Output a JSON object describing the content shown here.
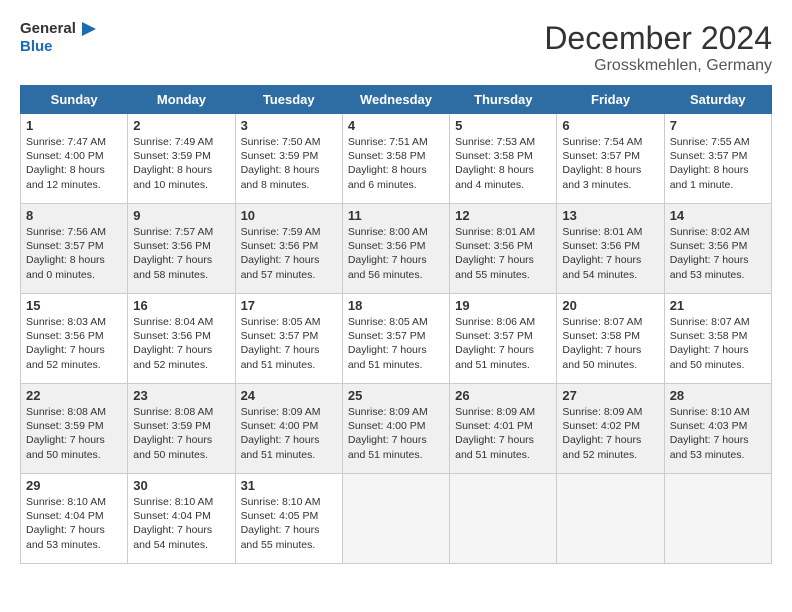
{
  "header": {
    "logo_line1": "General",
    "logo_line2": "Blue",
    "title": "December 2024",
    "subtitle": "Grosskmehlen, Germany"
  },
  "days_of_week": [
    "Sunday",
    "Monday",
    "Tuesday",
    "Wednesday",
    "Thursday",
    "Friday",
    "Saturday"
  ],
  "weeks": [
    [
      {
        "num": "1",
        "info": "Sunrise: 7:47 AM\nSunset: 4:00 PM\nDaylight: 8 hours\nand 12 minutes.",
        "shade": false
      },
      {
        "num": "2",
        "info": "Sunrise: 7:49 AM\nSunset: 3:59 PM\nDaylight: 8 hours\nand 10 minutes.",
        "shade": false
      },
      {
        "num": "3",
        "info": "Sunrise: 7:50 AM\nSunset: 3:59 PM\nDaylight: 8 hours\nand 8 minutes.",
        "shade": false
      },
      {
        "num": "4",
        "info": "Sunrise: 7:51 AM\nSunset: 3:58 PM\nDaylight: 8 hours\nand 6 minutes.",
        "shade": false
      },
      {
        "num": "5",
        "info": "Sunrise: 7:53 AM\nSunset: 3:58 PM\nDaylight: 8 hours\nand 4 minutes.",
        "shade": false
      },
      {
        "num": "6",
        "info": "Sunrise: 7:54 AM\nSunset: 3:57 PM\nDaylight: 8 hours\nand 3 minutes.",
        "shade": false
      },
      {
        "num": "7",
        "info": "Sunrise: 7:55 AM\nSunset: 3:57 PM\nDaylight: 8 hours\nand 1 minute.",
        "shade": false
      }
    ],
    [
      {
        "num": "8",
        "info": "Sunrise: 7:56 AM\nSunset: 3:57 PM\nDaylight: 8 hours\nand 0 minutes.",
        "shade": true
      },
      {
        "num": "9",
        "info": "Sunrise: 7:57 AM\nSunset: 3:56 PM\nDaylight: 7 hours\nand 58 minutes.",
        "shade": true
      },
      {
        "num": "10",
        "info": "Sunrise: 7:59 AM\nSunset: 3:56 PM\nDaylight: 7 hours\nand 57 minutes.",
        "shade": true
      },
      {
        "num": "11",
        "info": "Sunrise: 8:00 AM\nSunset: 3:56 PM\nDaylight: 7 hours\nand 56 minutes.",
        "shade": true
      },
      {
        "num": "12",
        "info": "Sunrise: 8:01 AM\nSunset: 3:56 PM\nDaylight: 7 hours\nand 55 minutes.",
        "shade": true
      },
      {
        "num": "13",
        "info": "Sunrise: 8:01 AM\nSunset: 3:56 PM\nDaylight: 7 hours\nand 54 minutes.",
        "shade": true
      },
      {
        "num": "14",
        "info": "Sunrise: 8:02 AM\nSunset: 3:56 PM\nDaylight: 7 hours\nand 53 minutes.",
        "shade": true
      }
    ],
    [
      {
        "num": "15",
        "info": "Sunrise: 8:03 AM\nSunset: 3:56 PM\nDaylight: 7 hours\nand 52 minutes.",
        "shade": false
      },
      {
        "num": "16",
        "info": "Sunrise: 8:04 AM\nSunset: 3:56 PM\nDaylight: 7 hours\nand 52 minutes.",
        "shade": false
      },
      {
        "num": "17",
        "info": "Sunrise: 8:05 AM\nSunset: 3:57 PM\nDaylight: 7 hours\nand 51 minutes.",
        "shade": false
      },
      {
        "num": "18",
        "info": "Sunrise: 8:05 AM\nSunset: 3:57 PM\nDaylight: 7 hours\nand 51 minutes.",
        "shade": false
      },
      {
        "num": "19",
        "info": "Sunrise: 8:06 AM\nSunset: 3:57 PM\nDaylight: 7 hours\nand 51 minutes.",
        "shade": false
      },
      {
        "num": "20",
        "info": "Sunrise: 8:07 AM\nSunset: 3:58 PM\nDaylight: 7 hours\nand 50 minutes.",
        "shade": false
      },
      {
        "num": "21",
        "info": "Sunrise: 8:07 AM\nSunset: 3:58 PM\nDaylight: 7 hours\nand 50 minutes.",
        "shade": false
      }
    ],
    [
      {
        "num": "22",
        "info": "Sunrise: 8:08 AM\nSunset: 3:59 PM\nDaylight: 7 hours\nand 50 minutes.",
        "shade": true
      },
      {
        "num": "23",
        "info": "Sunrise: 8:08 AM\nSunset: 3:59 PM\nDaylight: 7 hours\nand 50 minutes.",
        "shade": true
      },
      {
        "num": "24",
        "info": "Sunrise: 8:09 AM\nSunset: 4:00 PM\nDaylight: 7 hours\nand 51 minutes.",
        "shade": true
      },
      {
        "num": "25",
        "info": "Sunrise: 8:09 AM\nSunset: 4:00 PM\nDaylight: 7 hours\nand 51 minutes.",
        "shade": true
      },
      {
        "num": "26",
        "info": "Sunrise: 8:09 AM\nSunset: 4:01 PM\nDaylight: 7 hours\nand 51 minutes.",
        "shade": true
      },
      {
        "num": "27",
        "info": "Sunrise: 8:09 AM\nSunset: 4:02 PM\nDaylight: 7 hours\nand 52 minutes.",
        "shade": true
      },
      {
        "num": "28",
        "info": "Sunrise: 8:10 AM\nSunset: 4:03 PM\nDaylight: 7 hours\nand 53 minutes.",
        "shade": true
      }
    ],
    [
      {
        "num": "29",
        "info": "Sunrise: 8:10 AM\nSunset: 4:04 PM\nDaylight: 7 hours\nand 53 minutes.",
        "shade": false
      },
      {
        "num": "30",
        "info": "Sunrise: 8:10 AM\nSunset: 4:04 PM\nDaylight: 7 hours\nand 54 minutes.",
        "shade": false
      },
      {
        "num": "31",
        "info": "Sunrise: 8:10 AM\nSunset: 4:05 PM\nDaylight: 7 hours\nand 55 minutes.",
        "shade": false
      },
      {
        "num": "",
        "info": "",
        "shade": false,
        "empty": true
      },
      {
        "num": "",
        "info": "",
        "shade": false,
        "empty": true
      },
      {
        "num": "",
        "info": "",
        "shade": false,
        "empty": true
      },
      {
        "num": "",
        "info": "",
        "shade": false,
        "empty": true
      }
    ]
  ]
}
